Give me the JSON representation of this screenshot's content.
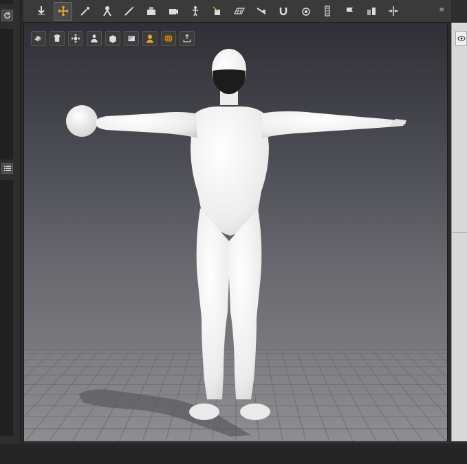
{
  "toolbar": {
    "tools": [
      {
        "name": "drop-tool-icon",
        "active": false
      },
      {
        "name": "universal-move-tool-icon",
        "active": true
      },
      {
        "name": "pose-tool-icon",
        "active": false
      },
      {
        "name": "joint-editor-icon",
        "active": false
      },
      {
        "name": "node-weight-brush-icon",
        "active": false
      },
      {
        "name": "surface-tool-icon",
        "active": false
      },
      {
        "name": "rotate-camera-icon",
        "active": false
      },
      {
        "name": "figure-setup-icon",
        "active": false
      },
      {
        "name": "region-navigator-icon",
        "active": false
      },
      {
        "name": "geometry-editor-icon",
        "active": false
      },
      {
        "name": "transform-tool-icon",
        "active": false
      },
      {
        "name": "magnet-tool-icon",
        "active": false
      },
      {
        "name": "spot-render-icon",
        "active": false
      },
      {
        "name": "smoothing-icon",
        "active": false
      },
      {
        "name": "flag-tool-icon",
        "active": false
      },
      {
        "name": "bars-tool-icon",
        "active": false
      },
      {
        "name": "align-tool-icon",
        "active": false
      }
    ],
    "overflow_label": "»"
  },
  "viewport": {
    "tools": [
      {
        "name": "perspective-view-icon"
      },
      {
        "name": "wardrobe-icon"
      },
      {
        "name": "settings-flower-icon"
      },
      {
        "name": "figure-user-icon"
      },
      {
        "name": "box-view-icon"
      },
      {
        "name": "shade-icon"
      },
      {
        "name": "avatar-head-icon"
      },
      {
        "name": "globe-icon"
      },
      {
        "name": "export-icon"
      }
    ]
  },
  "colors": {
    "accent": "#e0a030",
    "panel": "#3a3a3a",
    "figure": "#f2f2f2",
    "mask": "#1a1a1a"
  }
}
